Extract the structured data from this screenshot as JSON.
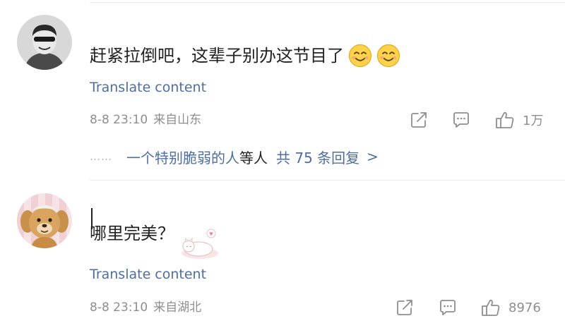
{
  "comments": [
    {
      "text": "赶紧拉倒吧，这辈子别办这节目了",
      "emojis": [
        "smile-emoji",
        "smile-emoji"
      ],
      "translate_label": "Translate content",
      "date": "8-8 23:10",
      "location": "来自山东",
      "like_count": "1万",
      "replies": {
        "ellipsis": "……",
        "users": "一个特别脆弱的人",
        "suffix": "等人",
        "total": "共 75 条回复",
        "chevron": ">"
      }
    },
    {
      "text": "哪里完美？",
      "translate_label": "Translate content",
      "date": "8-8 23:10",
      "location": "来自湖北",
      "like_count": "8976"
    }
  ],
  "colors": {
    "link": "#4e6ea1",
    "meta": "#8e8e8e",
    "text": "#222222",
    "divider": "#ececec"
  }
}
